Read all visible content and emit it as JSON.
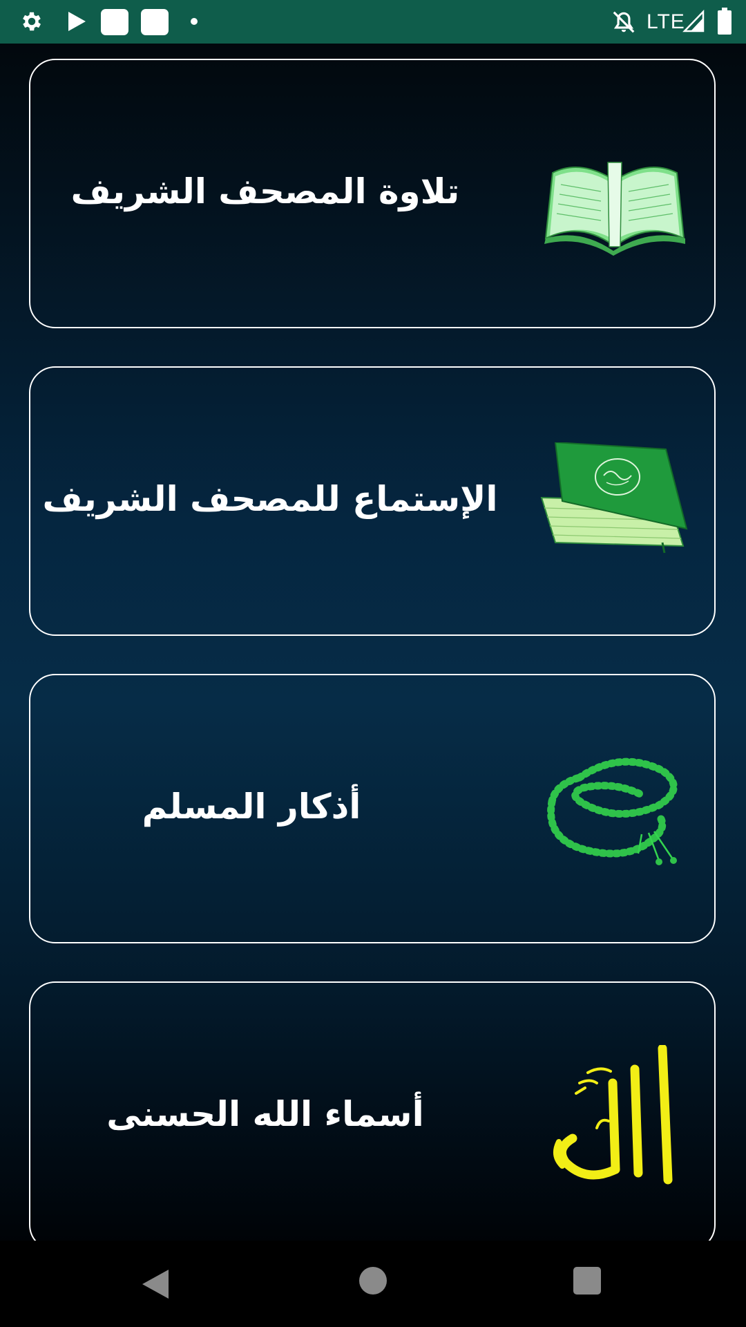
{
  "status_bar": {
    "network": "LTE",
    "icons": [
      "settings-gear-icon",
      "play-store-icon",
      "notification-square-icon",
      "notification-square-icon",
      "dot-icon",
      "notifications-off-icon",
      "signal-icon",
      "battery-icon"
    ]
  },
  "menu": {
    "items": [
      {
        "label": "تلاوة المصحف الشريف",
        "icon": "open-quran-icon"
      },
      {
        "label": "الإستماع للمصحف الشريف",
        "icon": "closed-quran-book-icon"
      },
      {
        "label": "أذكار المسلم",
        "icon": "prayer-beads-icon"
      },
      {
        "label": "أسماء الله الحسنى",
        "icon": "allah-calligraphy-icon"
      }
    ]
  },
  "colors": {
    "status_bar": "#0f5d4b",
    "card_border": "#ffffff",
    "text": "#ffffff",
    "icon_green": "#2fc24a",
    "calligraphy_yellow": "#f2ee16"
  },
  "nav_bar": {
    "buttons": [
      "back-icon",
      "home-icon",
      "recents-icon"
    ]
  }
}
